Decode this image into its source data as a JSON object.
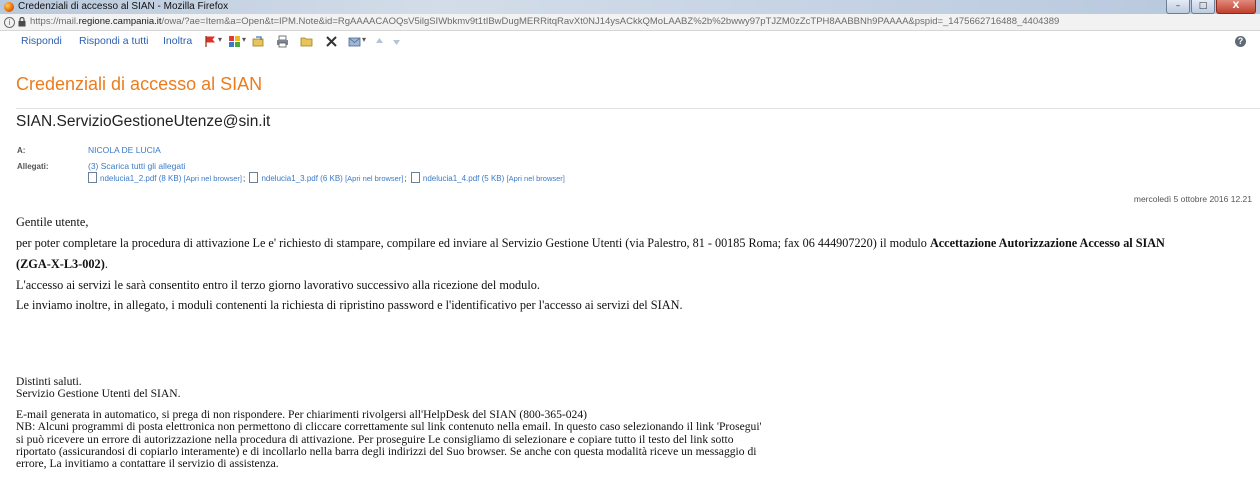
{
  "window": {
    "title": "Credenziali di accesso al SIAN - Mozilla Firefox",
    "minimize": "–",
    "maximize": "□",
    "close": "X"
  },
  "address": {
    "url_prefix": "https://mail.",
    "url_domain": "regione.campania.it",
    "url_rest": "/owa/?ae=Item&a=Open&t=IPM.Note&id=RgAAAACAOQsV5ilgSIWbkmv9t1tIBwDugMERRitqRavXt0NJ14ysACkkQMoLAABZ%2b%2bwwy97pTJZM0zZcTPH8AABBNh9PAAAA&pspid=_1475662716488_4404389"
  },
  "toolbar": {
    "reply": "Rispondi",
    "reply_all": "Rispondi a tutti",
    "forward": "Inoltra"
  },
  "message": {
    "subject": "Credenziali di accesso al SIAN",
    "sender": "SIAN.ServizioGestioneUtenze@sin.it",
    "to_label": "A:",
    "to_value": "NICOLA DE LUCIA",
    "attachments_label": "Allegati:",
    "attachments_summary": "(3)  Scarica tutti gli allegati",
    "attachments": [
      {
        "name": "ndelucia1_2.pdf (8 KB)",
        "open": "[Apri nel browser]"
      },
      {
        "name": "ndelucia1_3.pdf (6 KB)",
        "open": "[Apri nel browser]"
      },
      {
        "name": "ndelucia1_4.pdf (5 KB)",
        "open": "[Apri nel browser]"
      }
    ],
    "date": "mercoledì 5 ottobre 2016 12.21"
  },
  "body": {
    "greeting": "Gentile utente,",
    "p1_part1": "per poter completare la procedura di attivazione Le e' richiesto di stampare, compilare ed inviare al Servizio Gestione Utenti (via Palestro, 81 - 00185 Roma; fax 06 444907220) il modulo ",
    "p1_bold": "Accettazione Autorizzazione Accesso al SIAN",
    "p1_line2_bold": "(ZGA-X-L3-002)",
    "p1_line2_end": ".",
    "p2": "L'accesso ai servizi le sarà consentito entro il terzo giorno lavorativo successivo alla ricezione del modulo.",
    "p3": "Le inviamo inoltre, in allegato, i moduli contenenti la richiesta di ripristino password e l'identificativo per l'accesso ai servizi del SIAN.",
    "closing1": "Distinti saluti.",
    "closing2": "Servizio Gestione Utenti del SIAN.",
    "footer1": "E-mail generata in automatico, si prega di non rispondere. Per chiarimenti rivolgersi all'HelpDesk del SIAN (800-365-024)",
    "footer2": "NB: Alcuni programmi di posta elettronica non permettono di cliccare correttamente sul link contenuto nella email. In questo caso selezionando il link 'Prosegui'",
    "footer3": "si può ricevere un errore di autorizzazione nella procedura di attivazione. Per proseguire Le consigliamo di selezionare e copiare tutto il testo del link sotto",
    "footer4": "riportato (assicurandosi di copiarlo interamente) e di incollarlo nella barra degli indirizzi del Suo browser. Se anche con questa modalità riceve un messaggio di",
    "footer5": "errore, La invitiamo a contattare il servizio di assistenza."
  },
  "colors": {
    "subject": "#ec7c1d",
    "link": "#2a5fb0",
    "titlebar": "#c5d3e4"
  },
  "icons": [
    "firefox-icon",
    "info-icon",
    "lock-icon",
    "flag-icon",
    "categories-icon",
    "move-icon",
    "print-icon",
    "folder-icon",
    "delete-icon",
    "junk-icon",
    "previous-icon",
    "next-icon",
    "help-icon",
    "pdf-icon"
  ]
}
